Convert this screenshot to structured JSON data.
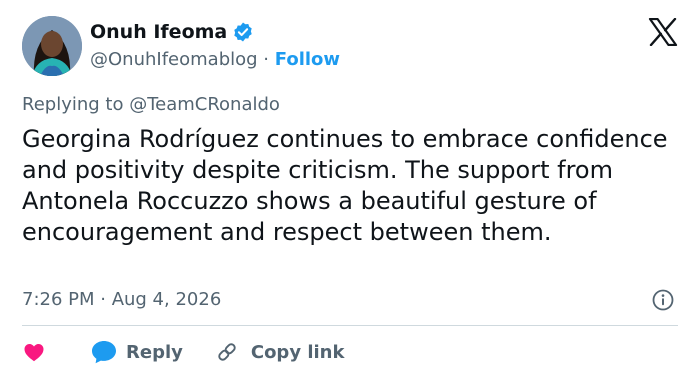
{
  "author": {
    "name": "Onuh Ifeoma",
    "handle": "@OnuhIfeomablog",
    "separator": "·",
    "follow_label": "Follow"
  },
  "reply_context": "Replying to @TeamCRonaldo",
  "tweet": {
    "text": "Georgina Rodríguez continues to embrace confidence and positivity despite criticism. The support from Antonela Roccuzzo shows a beautiful gesture of encouragement and respect between them.",
    "timestamp": "7:26 PM · Aug 4, 2026"
  },
  "actions": {
    "reply_label": "Reply",
    "copy_link_label": "Copy link"
  },
  "icons": {
    "brand": "x-logo-icon",
    "verified": "verified-badge-icon",
    "info": "info-icon",
    "like": "heart-icon",
    "reply": "speech-bubble-icon",
    "copy": "link-icon"
  },
  "colors": {
    "accent": "#1d9bf0",
    "like": "#f91880",
    "muted_text": "#536471",
    "text": "#0f1419",
    "divider": "#cfd9de"
  }
}
